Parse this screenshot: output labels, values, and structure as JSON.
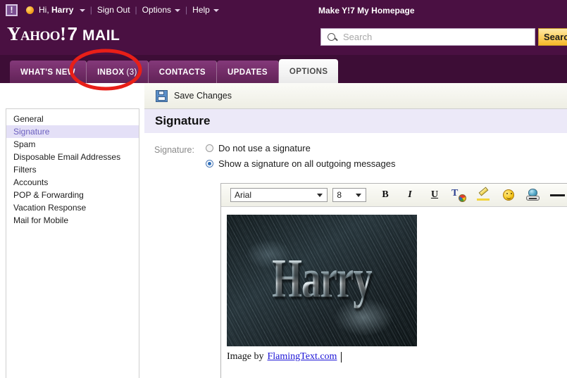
{
  "header": {
    "greeting_prefix": "Hi,",
    "user_name": "Harry",
    "sign_out": "Sign Out",
    "options": "Options",
    "help": "Help",
    "homepage_link": "Make Y!7 My Homepage",
    "logo_yahoo": "Yahoo!",
    "logo_seven": "7",
    "logo_mail": "MAIL",
    "separator": "|"
  },
  "search": {
    "placeholder": "Search",
    "value": "",
    "button_label": "Search"
  },
  "tabs": [
    {
      "label": "WHAT'S NEW",
      "count": "",
      "active": false
    },
    {
      "label": "INBOX",
      "count": "(3)",
      "active": false
    },
    {
      "label": "CONTACTS",
      "count": "",
      "active": false
    },
    {
      "label": "UPDATES",
      "count": "",
      "active": false
    },
    {
      "label": "OPTIONS",
      "count": "",
      "active": true
    }
  ],
  "sidebar": {
    "items": [
      {
        "label": "General",
        "selected": false
      },
      {
        "label": "Signature",
        "selected": true
      },
      {
        "label": "Spam",
        "selected": false
      },
      {
        "label": "Disposable Email Addresses",
        "selected": false
      },
      {
        "label": "Filters",
        "selected": false
      },
      {
        "label": "Accounts",
        "selected": false
      },
      {
        "label": "POP & Forwarding",
        "selected": false
      },
      {
        "label": "Vacation Response",
        "selected": false
      },
      {
        "label": "Mail for Mobile",
        "selected": false
      }
    ]
  },
  "toolbar": {
    "save_label": "Save Changes"
  },
  "main": {
    "heading": "Signature",
    "field_label": "Signature:",
    "radio_options": [
      {
        "label": "Do not use a signature",
        "checked": false
      },
      {
        "label": "Show a signature on all outgoing messages",
        "checked": true
      }
    ]
  },
  "editor": {
    "font_family_value": "Arial",
    "font_size_value": "8",
    "bold_label": "B",
    "italic_label": "I",
    "underline_label": "U",
    "text_color_label": "T",
    "signature_image_text": "Harry",
    "caption_prefix": "Image by",
    "caption_link": "FlamingText.com"
  },
  "annotation": {
    "shape": "ellipse",
    "color": "#e81f18",
    "target": "INBOX (3)"
  },
  "colors": {
    "header_purple": "#4a1042",
    "tabstrip_purple": "#3d0d36",
    "tab_purple": "#6e2a63",
    "selected_item_bg": "#e4e0f7",
    "selected_item_text": "#6b5fbf",
    "heading_band": "#ece9f8",
    "search_button_gold": "#fdd267",
    "link_blue": "#1a12d6",
    "annotation_red": "#e81f18"
  }
}
